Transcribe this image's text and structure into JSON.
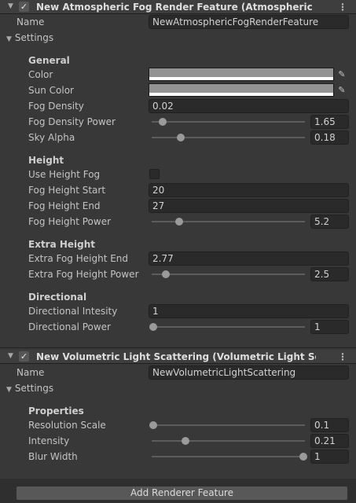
{
  "fog": {
    "title": "New Atmospheric Fog Render Feature (Atmospheric Fog Re",
    "name_label": "Name",
    "name_value": "NewAtmosphericFogRenderFeature",
    "settings_label": "Settings",
    "general_heading": "General",
    "color_label": "Color",
    "sun_color_label": "Sun Color",
    "color_value": "#939393",
    "sun_color_value": "#939393",
    "fog_density_label": "Fog Density",
    "fog_density_value": "0.02",
    "fog_density_power_label": "Fog Density Power",
    "fog_density_power_value": "1.65",
    "sky_alpha_label": "Sky Alpha",
    "sky_alpha_value": "0.18",
    "height_heading": "Height",
    "use_height_fog_label": "Use Height Fog",
    "use_height_fog_checked": false,
    "fog_height_start_label": "Fog Height Start",
    "fog_height_start_value": "20",
    "fog_height_end_label": "Fog Height End",
    "fog_height_end_value": "27",
    "fog_height_power_label": "Fog Height Power",
    "fog_height_power_value": "5.2",
    "extra_height_heading": "Extra Height",
    "extra_fog_height_end_label": "Extra Fog Height End",
    "extra_fog_height_end_value": "2.77",
    "extra_fog_height_power_label": "Extra Fog Height Power",
    "extra_fog_height_power_value": "2.5",
    "directional_heading": "Directional",
    "directional_intensity_label": "Directional Intesity",
    "directional_intensity_value": "1",
    "directional_power_label": "Directional Power",
    "directional_power_value": "1"
  },
  "light": {
    "title": "New Volumetric Light Scattering (Volumetric Light Scatterir",
    "name_label": "Name",
    "name_value": "NewVolumetricLightScattering",
    "settings_label": "Settings",
    "properties_heading": "Properties",
    "resolution_scale_label": "Resolution Scale",
    "resolution_scale_value": "0.1",
    "intensity_label": "Intensity",
    "intensity_value": "0.21",
    "blur_width_label": "Blur Width",
    "blur_width_value": "1"
  },
  "slider_fractions": {
    "fog_density_power": 0.06,
    "sky_alpha": 0.18,
    "fog_height_power": 0.17,
    "extra_fog_height_power": 0.08,
    "directional_power": 0.0,
    "resolution_scale": 0.0,
    "intensity": 0.21,
    "blur_width": 0.98
  },
  "footer": {
    "add_renderer_feature_label": "Add Renderer Feature"
  }
}
